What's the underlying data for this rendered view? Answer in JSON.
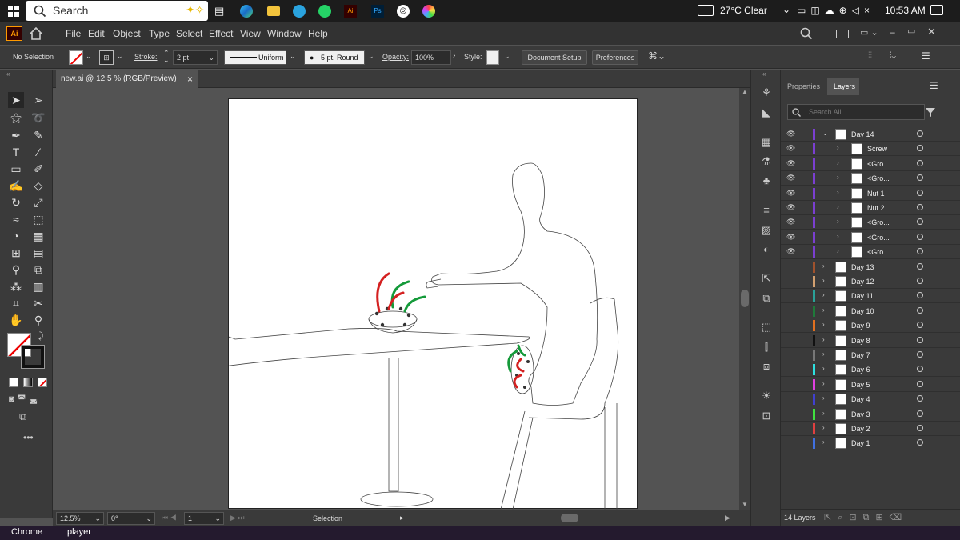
{
  "taskbar": {
    "search_placeholder": "Search",
    "weather": "27°C  Clear",
    "time": "10:53 AM"
  },
  "app": {
    "logo": "Ai",
    "menus": [
      "File",
      "Edit",
      "Object",
      "Type",
      "Select",
      "Effect",
      "View",
      "Window",
      "Help"
    ]
  },
  "control": {
    "selection": "No Selection",
    "stroke_label": "Stroke:",
    "stroke_value": "2 pt",
    "profile": "Uniform",
    "brush": "5 pt. Round",
    "opacity_label": "Opacity:",
    "opacity_value": "100%",
    "style_label": "Style:",
    "doc_setup": "Document Setup",
    "preferences": "Preferences"
  },
  "document": {
    "tab_title": "new.ai @ 12.5 % (RGB/Preview)",
    "close": "×"
  },
  "status": {
    "zoom": "12.5%",
    "rotation": "0°",
    "artboard": "1",
    "tool": "Selection"
  },
  "panel": {
    "tab_properties": "Properties",
    "tab_layers": "Layers",
    "search_placeholder": "Search All",
    "layer_count": "14 Layers",
    "layers": [
      {
        "name": "Day 14",
        "color": "#7b3fd1",
        "expanded": true,
        "visible": true
      },
      {
        "name": "Screw",
        "color": "#7b3fd1",
        "sub": true,
        "visible": true
      },
      {
        "name": "<Gro...",
        "color": "#7b3fd1",
        "sub": true,
        "visible": true
      },
      {
        "name": "<Gro...",
        "color": "#7b3fd1",
        "sub": true,
        "visible": true
      },
      {
        "name": "Nut 1",
        "color": "#7b3fd1",
        "sub": true,
        "visible": true
      },
      {
        "name": "Nut 2",
        "color": "#7b3fd1",
        "sub": true,
        "visible": true
      },
      {
        "name": "<Gro...",
        "color": "#7b3fd1",
        "sub": true,
        "visible": true
      },
      {
        "name": "<Gro...",
        "color": "#7b3fd1",
        "sub": true,
        "visible": true
      },
      {
        "name": "<Gro...",
        "color": "#7b3fd1",
        "sub": true,
        "visible": true
      },
      {
        "name": "Day 13",
        "color": "#a0522d",
        "visible": false
      },
      {
        "name": "Day 12",
        "color": "#d2a070",
        "visible": false
      },
      {
        "name": "Day 11",
        "color": "#2aa198",
        "visible": false
      },
      {
        "name": "Day 10",
        "color": "#1f7a3a",
        "visible": false
      },
      {
        "name": "Day 9",
        "color": "#e07020",
        "visible": false
      },
      {
        "name": "Day 8",
        "color": "#111111",
        "visible": false
      },
      {
        "name": "Day 7",
        "color": "#777777",
        "visible": false
      },
      {
        "name": "Day 6",
        "color": "#2ee0e0",
        "visible": false
      },
      {
        "name": "Day 5",
        "color": "#e040e0",
        "visible": false
      },
      {
        "name": "Day 4",
        "color": "#4040d0",
        "visible": false
      },
      {
        "name": "Day 3",
        "color": "#40e040",
        "visible": false
      },
      {
        "name": "Day 2",
        "color": "#e04040",
        "visible": false
      },
      {
        "name": "Day 1",
        "color": "#4070e0",
        "visible": false
      }
    ]
  },
  "bottom": {
    "chrome": "Chrome",
    "player": "player"
  }
}
